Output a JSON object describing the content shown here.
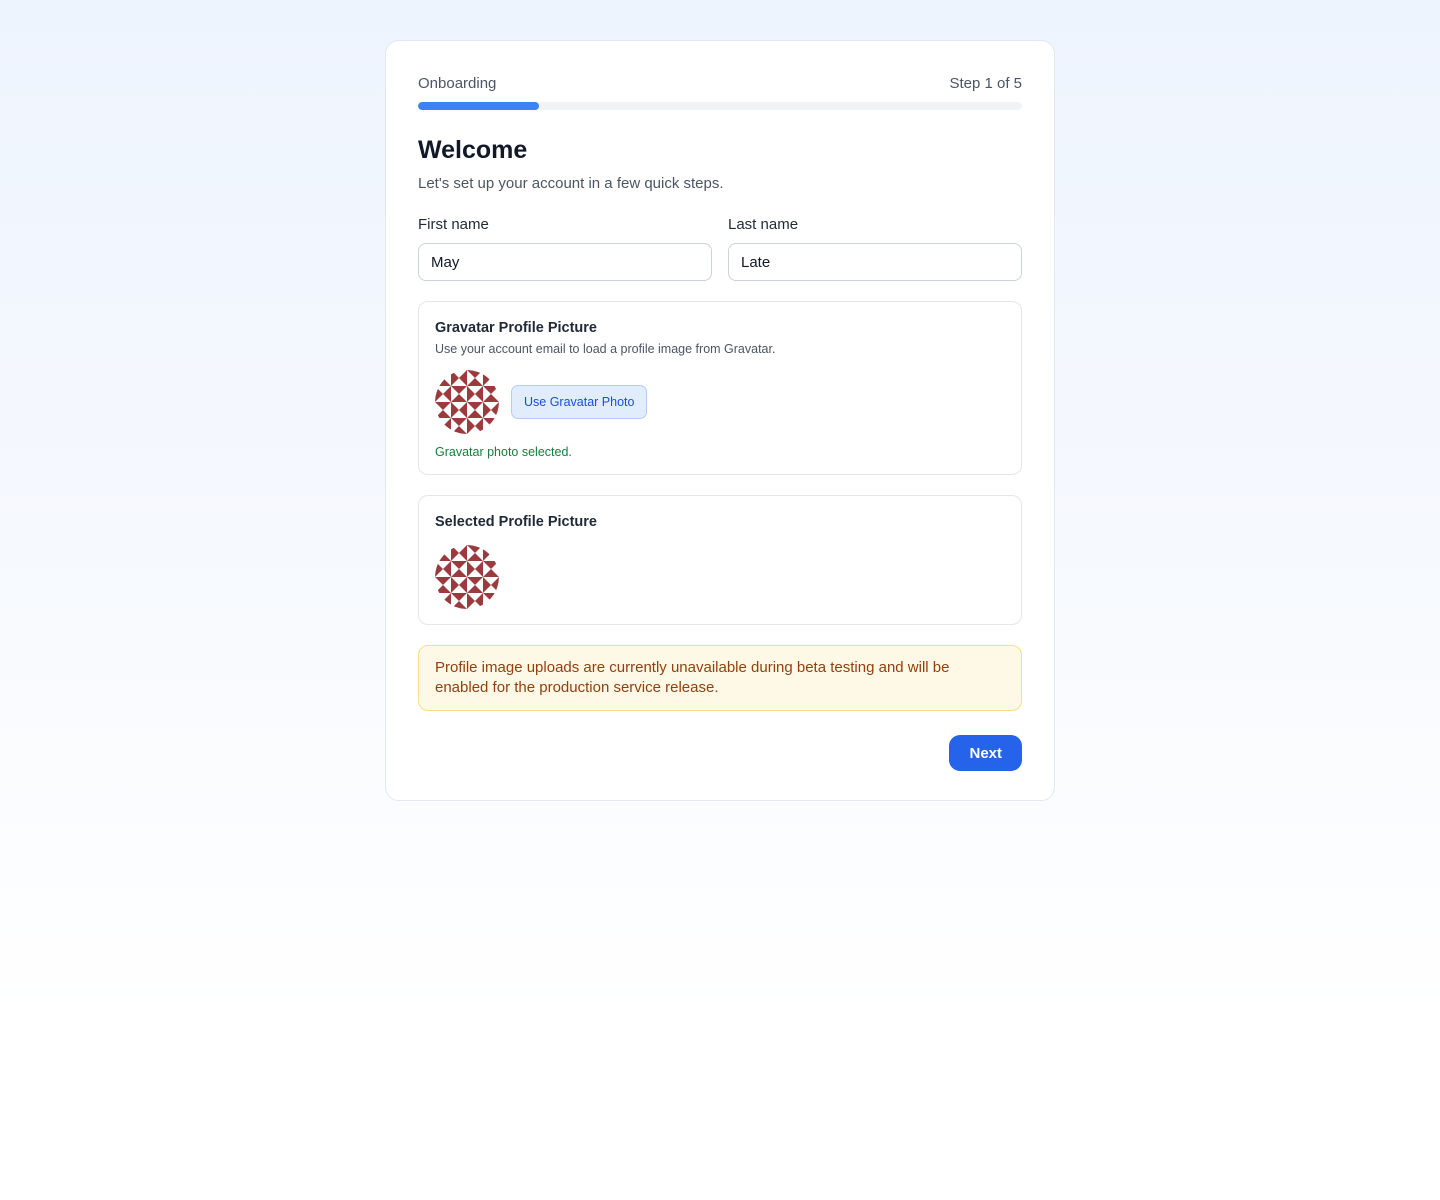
{
  "onboarding": {
    "label": "Onboarding",
    "step_text": "Step 1 of 5",
    "progress_fraction": 0.2,
    "accent_color": "#3b82f6"
  },
  "header": {
    "title": "Welcome",
    "subtitle": "Let's set up your account in a few quick steps."
  },
  "form": {
    "first_name": {
      "label": "First name",
      "value": "May"
    },
    "last_name": {
      "label": "Last name",
      "value": "Late"
    }
  },
  "gravatar": {
    "title": "Gravatar Profile Picture",
    "description": "Use your account email to load a profile image from Gravatar.",
    "button_label": "Use Gravatar Photo",
    "status": "Gravatar photo selected.",
    "avatar_color": "#9b3b3e"
  },
  "selected": {
    "title": "Selected Profile Picture"
  },
  "notice": {
    "text": "Profile image uploads are currently unavailable during beta testing and will be enabled for the production service release."
  },
  "actions": {
    "next_label": "Next",
    "next_color": "#2563eb"
  }
}
